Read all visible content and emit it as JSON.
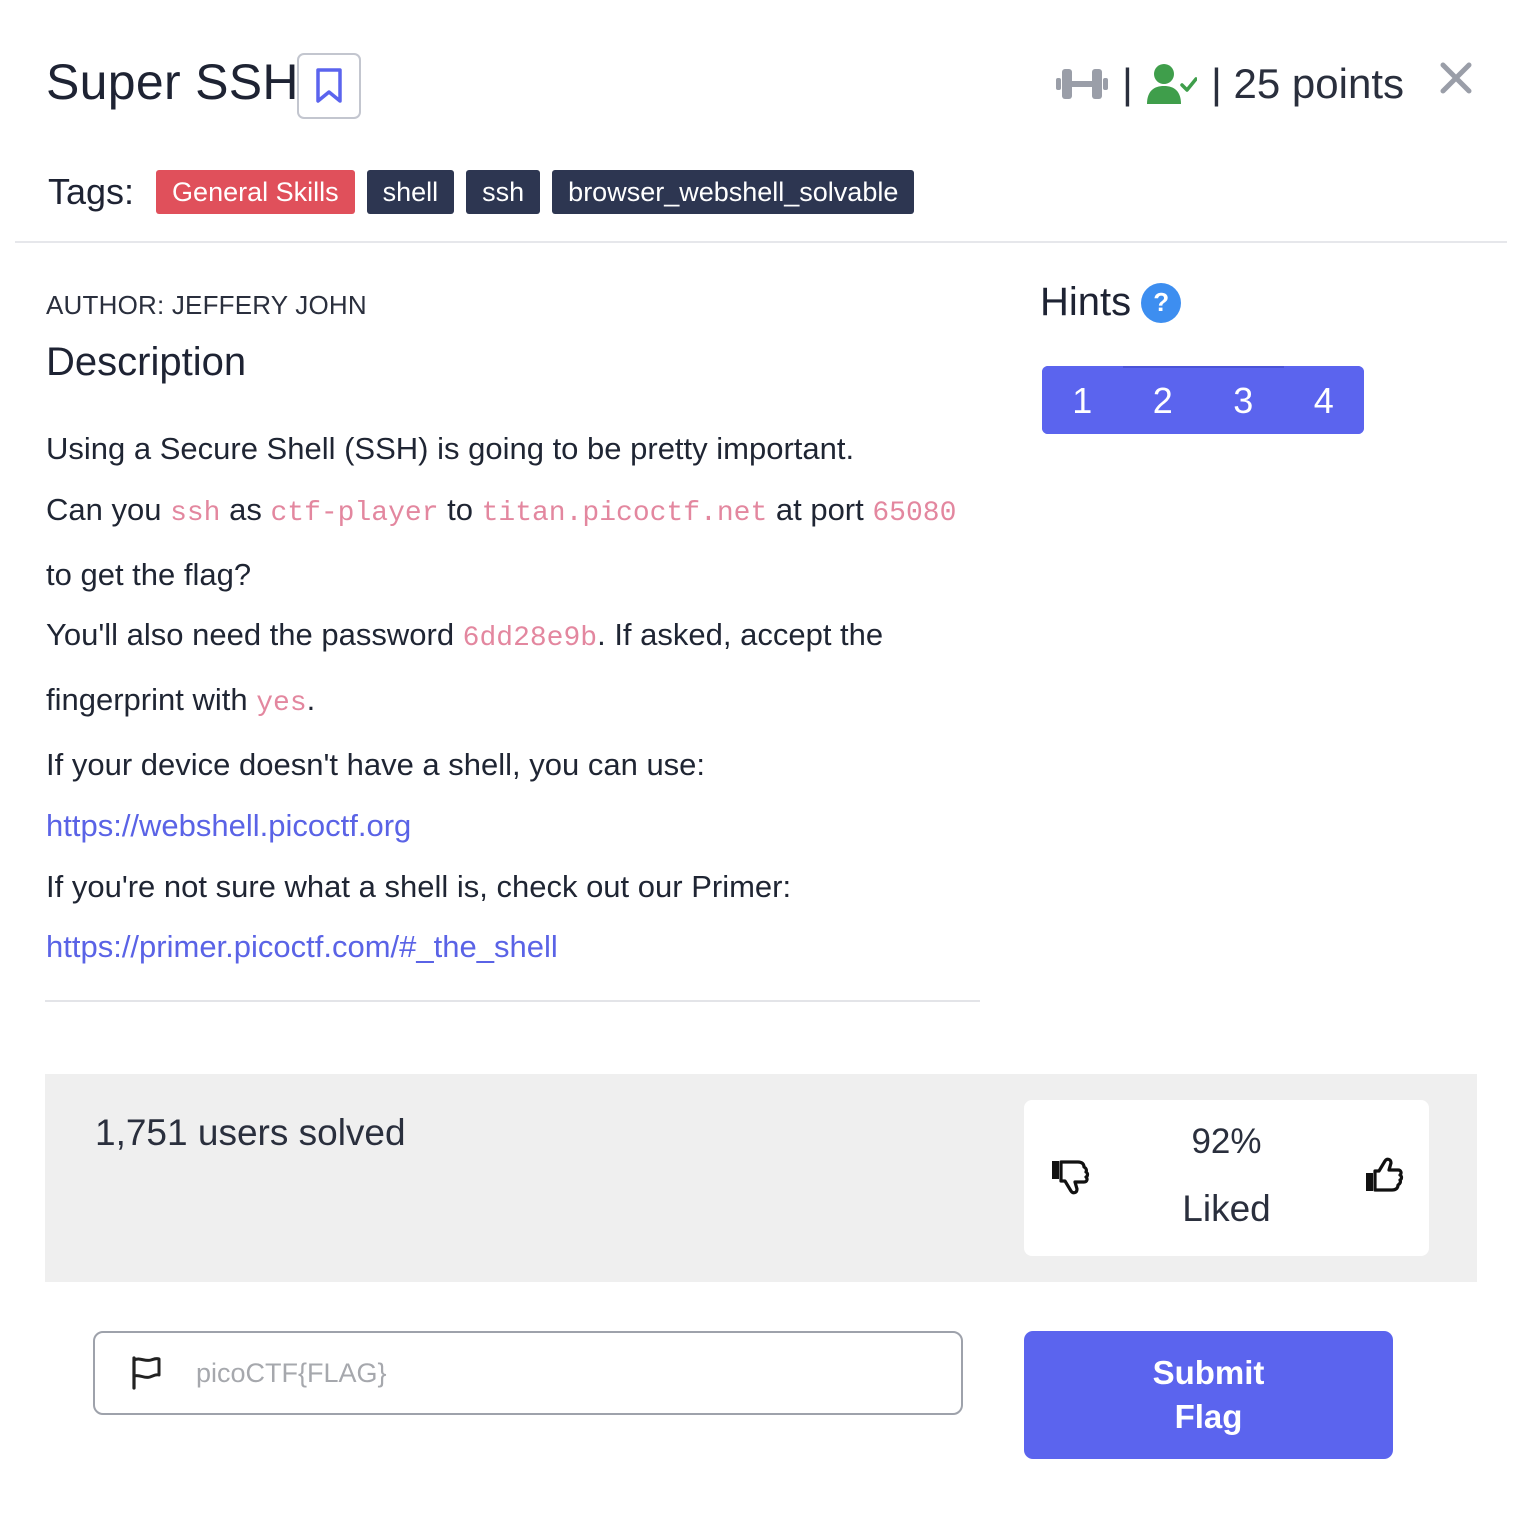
{
  "challenge": {
    "title": "Super SSH",
    "points_label": "| 25 points",
    "sep": "|"
  },
  "tags": {
    "label": "Tags:",
    "items": [
      "General Skills",
      "shell",
      "ssh",
      "browser_webshell_solvable"
    ]
  },
  "author": "AUTHOR: JEFFERY JOHN",
  "description": {
    "heading": "Description",
    "l1": "Using a Secure Shell (SSH) is going to be pretty important.",
    "l2_a": "Can you ",
    "l2_code1": "ssh",
    "l2_b": " as ",
    "l2_code2": "ctf-player",
    "l2_c": " to ",
    "l2_code3": "titan.picoctf.net",
    "l2_d": " at port ",
    "l2_code4": "65080",
    "l3": "to get the flag?",
    "l4_a": "You'll also need the password ",
    "l4_code": "6dd28e9b",
    "l4_b": ". If asked, accept the",
    "l5_a": "fingerprint with ",
    "l5_code": "yes",
    "l5_b": ".",
    "l6": "If your device doesn't have a shell, you can use:",
    "link1": "https://webshell.picoctf.org",
    "l7": "If you're not sure what a shell is, check out our Primer:",
    "link2": "https://primer.picoctf.com/#_the_shell"
  },
  "hints": {
    "heading": "Hints",
    "help_glyph": "?",
    "buttons": [
      "1",
      "2",
      "3",
      "4"
    ]
  },
  "stats": {
    "solved": "1,751 users solved",
    "liked_pct": "92%",
    "liked_label": "Liked"
  },
  "submit": {
    "placeholder": "picoCTF{FLAG}",
    "button_label": "Submit Flag"
  },
  "colors": {
    "accent": "#5b64ee",
    "tag_red": "#e0505b",
    "tag_dark": "#2d3651",
    "code_pink": "#e3879f",
    "solved_green": "#3f9e4b",
    "help_blue": "#3d8ef0"
  },
  "icons": {
    "bookmark": "bookmark-icon",
    "difficulty": "dumbbell-icon",
    "solved": "user-check-icon",
    "close": "close-icon",
    "help": "question-circle-icon",
    "dislike": "thumbs-down-icon",
    "like": "thumbs-up-icon",
    "flag": "flag-icon"
  }
}
